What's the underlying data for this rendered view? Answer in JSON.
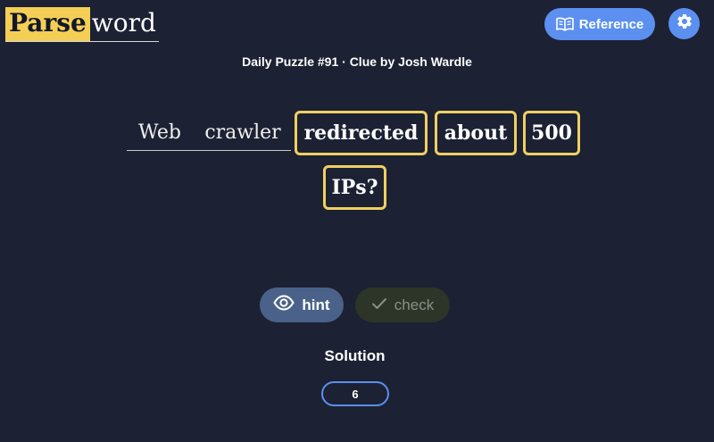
{
  "header": {
    "logo": {
      "part1": "Parse",
      "part2": "word"
    },
    "reference_label": "Reference",
    "settings_icon": "gear-icon",
    "reference_icon": "book-icon"
  },
  "puzzle": {
    "info": "Daily Puzzle #91 · Clue by Josh Wardle",
    "words": [
      {
        "text": "Web",
        "style": "plain"
      },
      {
        "text": "crawler",
        "style": "plain"
      },
      {
        "text": "redirected",
        "style": "boxed"
      },
      {
        "text": "about",
        "style": "boxed"
      },
      {
        "text": "500",
        "style": "boxed"
      },
      {
        "text": "IPs?",
        "style": "boxed"
      }
    ]
  },
  "actions": {
    "hint_label": "hint",
    "hint_icon": "eye-icon",
    "check_label": "check",
    "check_icon": "checkmark-icon"
  },
  "solution": {
    "label": "Solution",
    "length": "6"
  },
  "colors": {
    "background": "#1c2233",
    "accent_blue": "#5b8ff0",
    "highlight_yellow": "#f0cf63",
    "logo_yellow": "#f5cf55"
  }
}
